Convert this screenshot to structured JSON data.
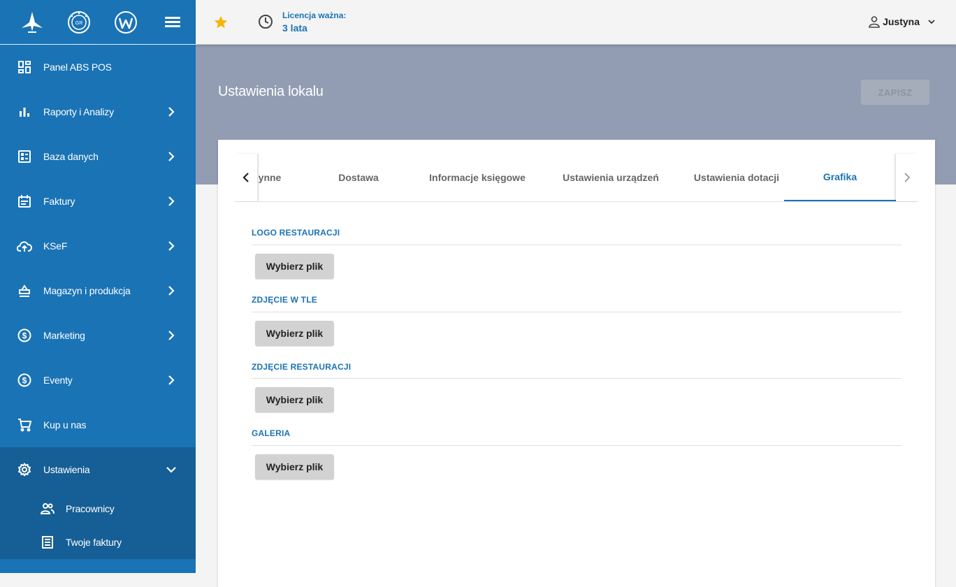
{
  "header": {
    "license_label": "Licencja ważna:",
    "license_value": "3 lata",
    "user_name": "Justyna"
  },
  "sidebar": {
    "items": [
      {
        "label": "Panel ABS POS"
      },
      {
        "label": "Raporty i Analizy"
      },
      {
        "label": "Baza danych"
      },
      {
        "label": "Faktury"
      },
      {
        "label": "KSeF"
      },
      {
        "label": "Magazyn i produkcja"
      },
      {
        "label": "Marketing"
      },
      {
        "label": "Eventy"
      },
      {
        "label": "Kup u nas"
      },
      {
        "label": "Ustawienia"
      }
    ],
    "subitems": [
      {
        "label": "Pracownicy"
      },
      {
        "label": "Twoje faktury"
      }
    ]
  },
  "main": {
    "title": "Ustawienia lokalu",
    "save_label": "ZAPISZ",
    "tabs": [
      {
        "label": "ynne"
      },
      {
        "label": "Dostawa"
      },
      {
        "label": "Informacje księgowe"
      },
      {
        "label": "Ustawienia urządzeń"
      },
      {
        "label": "Ustawienia dotacji"
      },
      {
        "label": "Grafika"
      }
    ],
    "active_tab": "Grafika",
    "sections": [
      {
        "title": "LOGO RESTAURACJI",
        "button": "Wybierz plik"
      },
      {
        "title": "ZDJĘCIE W TLE",
        "button": "Wybierz plik"
      },
      {
        "title": "ZDJĘCIE RESTAURACJI",
        "button": "Wybierz plik"
      },
      {
        "title": "GALERIA",
        "button": "Wybierz plik"
      }
    ]
  },
  "colors": {
    "sidebar": "#1a73b5",
    "sidebar_active": "#165f96",
    "accent": "#1a73b5",
    "band": "#929db4",
    "star": "#f5b50a"
  }
}
